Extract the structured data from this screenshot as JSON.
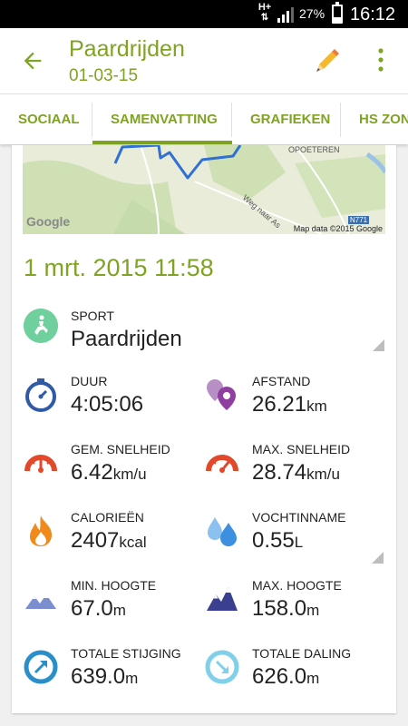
{
  "status_bar": {
    "network_top": "H+",
    "battery": "27%",
    "battery_level": 0.27,
    "time": "16:12"
  },
  "header": {
    "title": "Paardrijden",
    "subtitle": "01-03-15",
    "back_icon": "arrow-left-icon",
    "edit_icon": "pencil-icon",
    "menu_icon": "more-vert-icon"
  },
  "tabs": [
    {
      "label": "SOCIAAL",
      "active": false
    },
    {
      "label": "SAMENVATTING",
      "active": true
    },
    {
      "label": "GRAFIEKEN",
      "active": false
    },
    {
      "label": "HS ZON",
      "active": false
    }
  ],
  "map": {
    "place_label": "OPOETEREN",
    "road_label": "Weg naar As",
    "road_badge": "N771",
    "brand": "Google",
    "attribution": "Map data ©2015 Google"
  },
  "workout": {
    "datetime": "1 mrt. 2015 11:58",
    "sport_label": "SPORT",
    "sport_value": "Paardrijden"
  },
  "stats": [
    {
      "label": "DUUR",
      "value": "4:05:06",
      "unit": "",
      "icon": "stopwatch-icon"
    },
    {
      "label": "AFSTAND",
      "value": "26.21",
      "unit": "km",
      "icon": "location-pins-icon"
    },
    {
      "label": "GEM. SNELHEID",
      "value": "6.42",
      "unit": "km/u",
      "icon": "speedometer-icon"
    },
    {
      "label": "MAX. SNELHEID",
      "value": "28.74",
      "unit": "km/u",
      "icon": "speedometer-max-icon"
    },
    {
      "label": "CALORIEËN",
      "value": "2407",
      "unit": "kcal",
      "icon": "flame-icon"
    },
    {
      "label": "VOCHTINNAME",
      "value": "0.55",
      "unit": "L",
      "icon": "water-drops-icon"
    },
    {
      "label": "MIN. HOOGTE",
      "value": "67.0",
      "unit": "m",
      "icon": "mountain-min-icon"
    },
    {
      "label": "MAX. HOOGTE",
      "value": "158.0",
      "unit": "m",
      "icon": "mountain-max-icon"
    },
    {
      "label": "TOTALE STIJGING",
      "value": "639.0",
      "unit": "m",
      "icon": "ascent-arrow-icon"
    },
    {
      "label": "TOTALE DALING",
      "value": "626.0",
      "unit": "m",
      "icon": "descent-arrow-icon"
    }
  ],
  "colors": {
    "accent": "#7fa322",
    "sport_icon": "#6fcf9d",
    "stopwatch": "#2f5aa8",
    "location": "#8e3fa0",
    "speed": "#e2492a",
    "flame": "#f08a1c",
    "water": "#3d8fe0",
    "mountain": "#3b3f8f",
    "ascent": "#2a8fc9",
    "descent": "#7fd0e8"
  }
}
